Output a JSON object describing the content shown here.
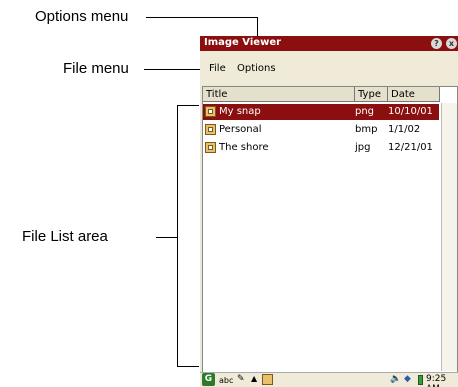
{
  "callouts": {
    "options_menu": "Options menu",
    "file_menu": "File menu",
    "file_list_area": "File List area"
  },
  "app": {
    "title": "Image Viewer",
    "help_btn": "?",
    "close_btn": "x"
  },
  "menubar": {
    "file": "File",
    "options": "Options"
  },
  "table": {
    "headers": [
      "Title",
      "Type",
      "Date"
    ],
    "rows": [
      {
        "title": "My snap",
        "type": "png",
        "date": "10/10/01",
        "selected": true
      },
      {
        "title": "Personal",
        "type": "bmp",
        "date": "1/1/02",
        "selected": false
      },
      {
        "title": "The shore",
        "type": "jpg",
        "date": "12/21/01",
        "selected": false
      }
    ]
  },
  "taskbar": {
    "input_mode": "abc",
    "clock": "9:25 AM",
    "icons": [
      "start-icon",
      "pen-icon",
      "up-arrow-icon",
      "image-viewer-icon",
      "speaker-icon",
      "network-icon",
      "battery-icon"
    ]
  },
  "colors": {
    "titlebar": "#8b0f0f",
    "selection": "#8b0f0f",
    "chrome": "#efebd8"
  }
}
